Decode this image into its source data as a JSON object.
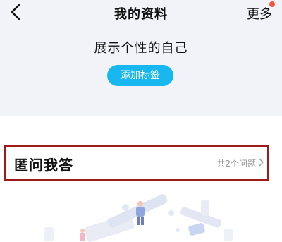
{
  "navbar": {
    "title": "我的资料",
    "more_label": "更多",
    "back_icon": "chevron-left-icon"
  },
  "tags": {
    "headline": "展示个性的自己",
    "add_tag_label": "添加标签"
  },
  "qa": {
    "title": "匿问我答",
    "count_label": "共2个问题"
  },
  "colors": {
    "accent": "#19b7ef",
    "badge": "#f0583c",
    "highlight_border": "#a01a1a",
    "section_bg": "#f2f3f8"
  }
}
